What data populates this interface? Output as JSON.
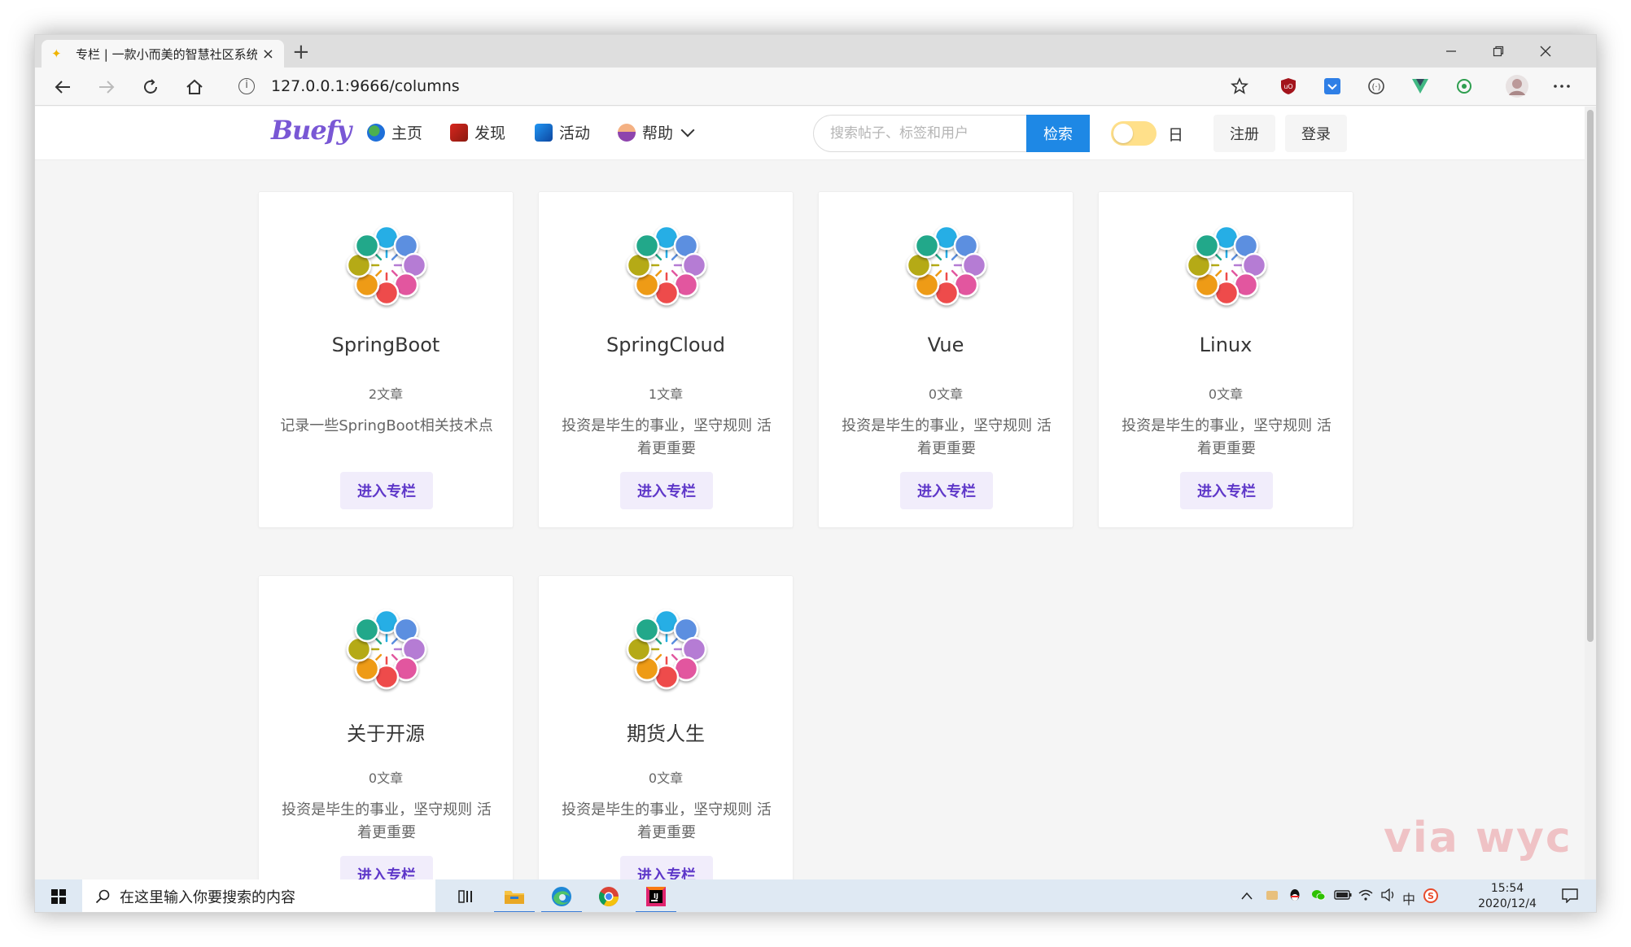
{
  "browser": {
    "tab_title": "专栏 | 一款小而美的智慧社区系统",
    "tab_close": "×",
    "new_tab": "+",
    "url": "127.0.0.1:9666/columns"
  },
  "header": {
    "brand": "Buefy",
    "nav": [
      {
        "label": "主页",
        "icon": "globe-icon"
      },
      {
        "label": "发现",
        "icon": "fire-icon"
      },
      {
        "label": "活动",
        "icon": "wave-icon"
      },
      {
        "label": "帮助",
        "icon": "person-icon"
      }
    ],
    "search_placeholder": "搜索帖子、标签和用户",
    "search_button": "检索",
    "theme_label": "日",
    "register": "注册",
    "login": "登录"
  },
  "columns": [
    {
      "title": "SpringBoot",
      "count": "2文章",
      "desc": "记录一些SpringBoot相关技术点",
      "action": "进入专栏"
    },
    {
      "title": "SpringCloud",
      "count": "1文章",
      "desc": "投资是毕生的事业，坚守规则 活着更重要",
      "action": "进入专栏"
    },
    {
      "title": "Vue",
      "count": "0文章",
      "desc": "投资是毕生的事业，坚守规则 活着更重要",
      "action": "进入专栏"
    },
    {
      "title": "Linux",
      "count": "0文章",
      "desc": "投资是毕生的事业，坚守规则 活着更重要",
      "action": "进入专栏"
    },
    {
      "title": "关于开源",
      "count": "0文章",
      "desc": "投资是毕生的事业，坚守规则 活着更重要",
      "action": "进入专栏"
    },
    {
      "title": "期货人生",
      "count": "0文章",
      "desc": "投资是毕生的事业，坚守规则 活着更重要",
      "action": "进入专栏"
    }
  ],
  "taskbar": {
    "search_text": "在这里输入你要搜索的内容",
    "time": "15:54",
    "date": "2020/12/4",
    "ime": "中"
  },
  "watermark": "via wyc",
  "colors": {
    "brand": "#7957d5",
    "search_button": "#1e88e5",
    "toggle": "#ffe08a",
    "card_button_bg": "#f1edfb",
    "card_button_text": "#5e37c9"
  }
}
